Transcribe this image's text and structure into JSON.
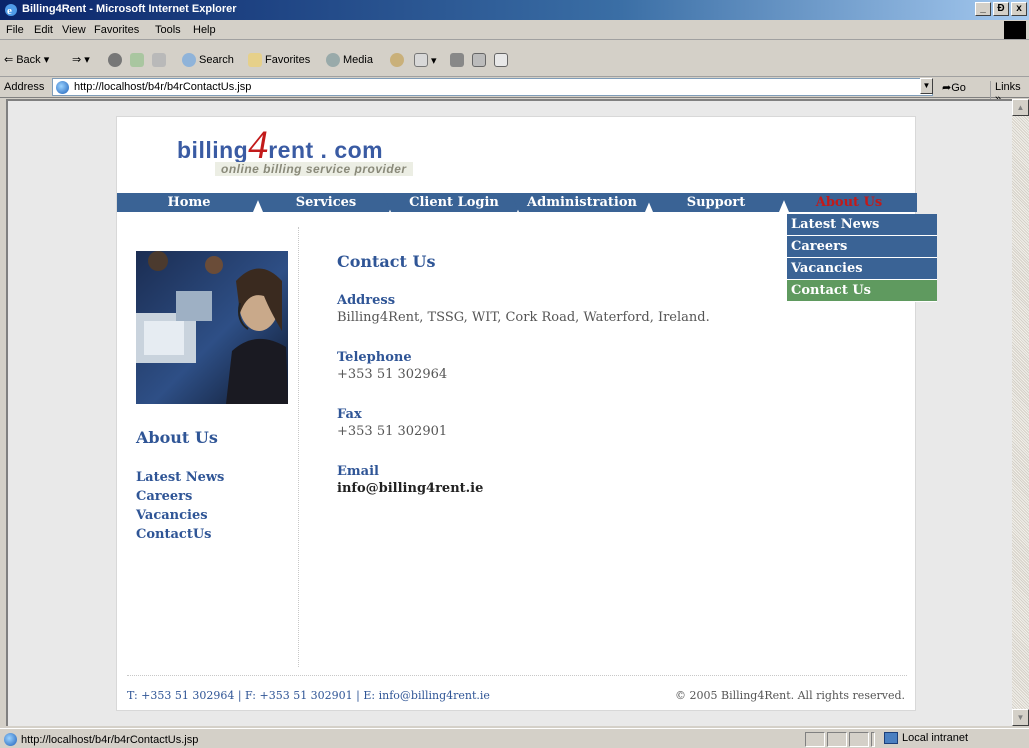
{
  "window": {
    "title": "Billing4Rent - Microsoft Internet Explorer",
    "min": "_",
    "max": "Ɖ",
    "close": "x"
  },
  "menubar": {
    "items": [
      "File",
      "Edit",
      "View",
      "Favorites",
      "Tools",
      "Help"
    ]
  },
  "toolbar": {
    "back": "Back",
    "search": "Search",
    "favorites": "Favorites",
    "media": "Media"
  },
  "address": {
    "label": "Address",
    "url": "http://localhost/b4r/b4rContactUs.jsp",
    "go": "Go",
    "links": "Links »"
  },
  "page": {
    "logo": {
      "part1": "billing",
      "four": "4",
      "part2": "rent . com",
      "tagline": "online billing service provider"
    },
    "nav": [
      "Home",
      "Services",
      "Client Login",
      "Administration",
      "Support",
      "About Us"
    ],
    "nav_active": "About Us",
    "dropdown": [
      "Latest News",
      "Careers",
      "Vacancies",
      "Contact Us"
    ],
    "dropdown_active": "Contact Us",
    "sidebar": {
      "title": "About Us",
      "links": [
        "Latest News",
        "Careers",
        "Vacancies",
        "ContactUs"
      ]
    },
    "content": {
      "heading": "Contact Us",
      "address_label": "Address",
      "address": "Billing4Rent, TSSG, WIT, Cork Road, Waterford, Ireland.",
      "telephone_label": "Telephone",
      "telephone": "+353 51 302964",
      "fax_label": "Fax",
      "fax": "+353 51 302901",
      "email_label": "Email",
      "email": "info@billing4rent.ie"
    },
    "footer": {
      "left": "T: +353 51 302964 | F: +353 51 302901 | E: info@billing4rent.ie",
      "right": "© 2005 Billing4Rent. All rights reserved."
    }
  },
  "statusbar": {
    "text": "http://localhost/b4r/b4rContactUs.jsp",
    "zone": "Local intranet"
  },
  "colors": {
    "nav": "#3a6395",
    "accent_red": "#c21a1a",
    "link_blue": "#2f5596",
    "active_green": "#5f9a5f"
  }
}
